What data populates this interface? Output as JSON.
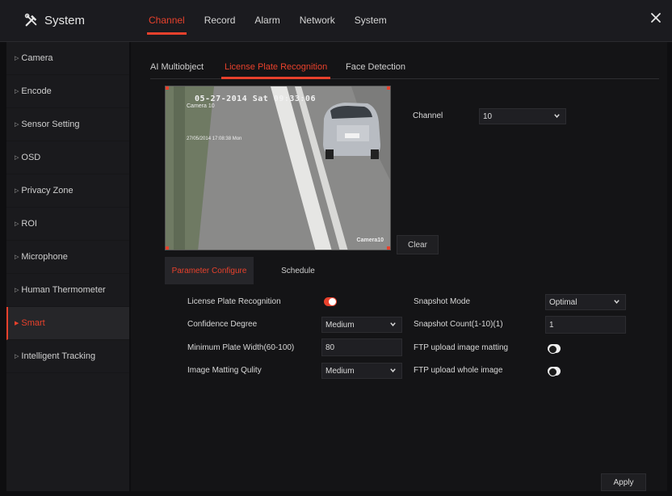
{
  "app": {
    "title": "System",
    "icon": "tools-icon"
  },
  "top_tabs": [
    {
      "label": "Channel",
      "active": true
    },
    {
      "label": "Record",
      "active": false
    },
    {
      "label": "Alarm",
      "active": false
    },
    {
      "label": "Network",
      "active": false
    },
    {
      "label": "System",
      "active": false
    }
  ],
  "close_icon": "close-icon",
  "sidebar": {
    "items": [
      {
        "label": "Camera",
        "active": false
      },
      {
        "label": "Encode",
        "active": false
      },
      {
        "label": "Sensor Setting",
        "active": false
      },
      {
        "label": "OSD",
        "active": false
      },
      {
        "label": "Privacy Zone",
        "active": false
      },
      {
        "label": "ROI",
        "active": false
      },
      {
        "label": "Microphone",
        "active": false
      },
      {
        "label": "Human Thermometer",
        "active": false
      },
      {
        "label": "Smart",
        "active": true
      },
      {
        "label": "Intelligent Tracking",
        "active": false
      }
    ]
  },
  "sub_tabs": [
    {
      "label": "AI Multiobject",
      "active": false
    },
    {
      "label": "License Plate Recognition",
      "active": true
    },
    {
      "label": "Face Detection",
      "active": false
    }
  ],
  "video": {
    "osd_time": "05-27-2014 Sat 09:33:06",
    "osd_cam": "Camera 10",
    "osd_small": "27/05/2014 17:08:38 Mon",
    "osd_name": "Camera10"
  },
  "clear_label": "Clear",
  "channel": {
    "label": "Channel",
    "value": "10"
  },
  "cfg_tabs": [
    {
      "label": "Parameter Configure",
      "active": true
    },
    {
      "label": "Schedule",
      "active": false
    }
  ],
  "params": {
    "lpr_label": "License Plate Recognition",
    "lpr_enabled": true,
    "confidence_label": "Confidence Degree",
    "confidence_value": "Medium",
    "min_width_label": "Minimum Plate Width(60-100)",
    "min_width_value": "80",
    "matting_quality_label": "Image Matting Qulity",
    "matting_quality_value": "Medium",
    "snapshot_mode_label": "Snapshot Mode",
    "snapshot_mode_value": "Optimal",
    "snapshot_count_label": "Snapshot Count(1-10)(1)",
    "snapshot_count_value": "1",
    "ftp_matting_label": "FTP upload image matting",
    "ftp_matting_enabled": false,
    "ftp_whole_label": "FTP upload whole image",
    "ftp_whole_enabled": false
  },
  "apply_label": "Apply",
  "colors": {
    "accent": "#e8412c",
    "background": "#141416",
    "panel": "#1b1b1f"
  }
}
